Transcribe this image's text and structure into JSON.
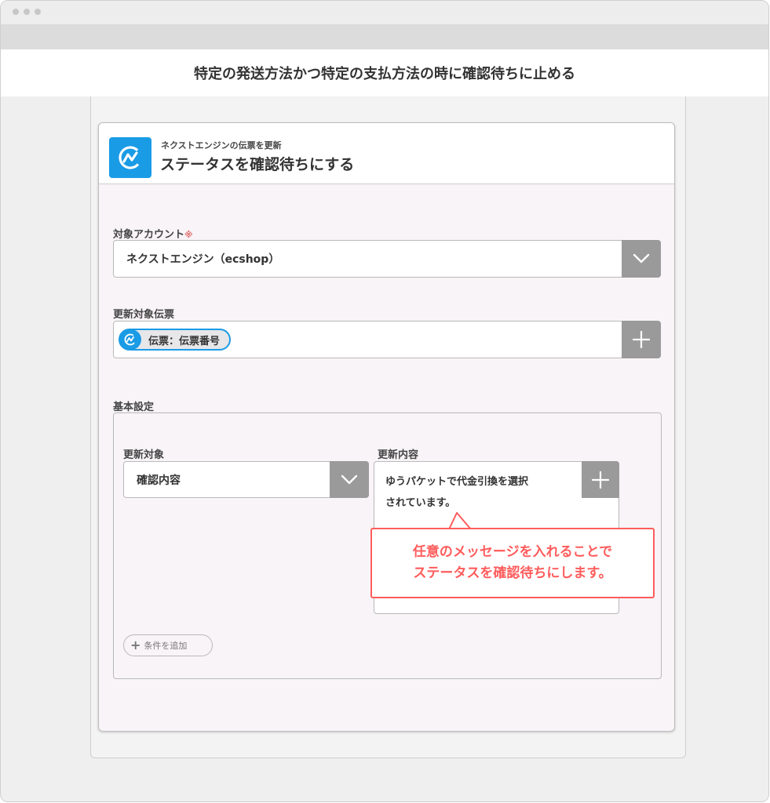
{
  "window": {
    "title": "特定の発送方法かつ特定の支払方法の時に確認待ちに止める"
  },
  "card": {
    "subtitle": "ネクストエンジンの伝票を更新",
    "title": "ステータスを確認待ちにする",
    "app_icon": "next-engine-logo-icon"
  },
  "account": {
    "label": "対象アカウント",
    "required_mark": "※",
    "value": "ネクストエンジン（ecshop）"
  },
  "target_slip": {
    "label": "更新対象伝票",
    "token": "伝票：伝票番号"
  },
  "basic_settings": {
    "label": "基本設定",
    "update_target": {
      "label": "更新対象",
      "value": "確認内容"
    },
    "update_content": {
      "label": "更新内容",
      "value_line1": "ゆうパケットで代金引換を選択",
      "value_line2": "されています。"
    },
    "add_condition_label": "条件を追加"
  },
  "callout": {
    "line1": "任意のメッセージを入れることで",
    "line2": "ステータスを確認待ちにします。"
  },
  "colors": {
    "accent": "#1a9be6",
    "callout": "#ff5c5c",
    "button_gray": "#9a9a9a"
  }
}
